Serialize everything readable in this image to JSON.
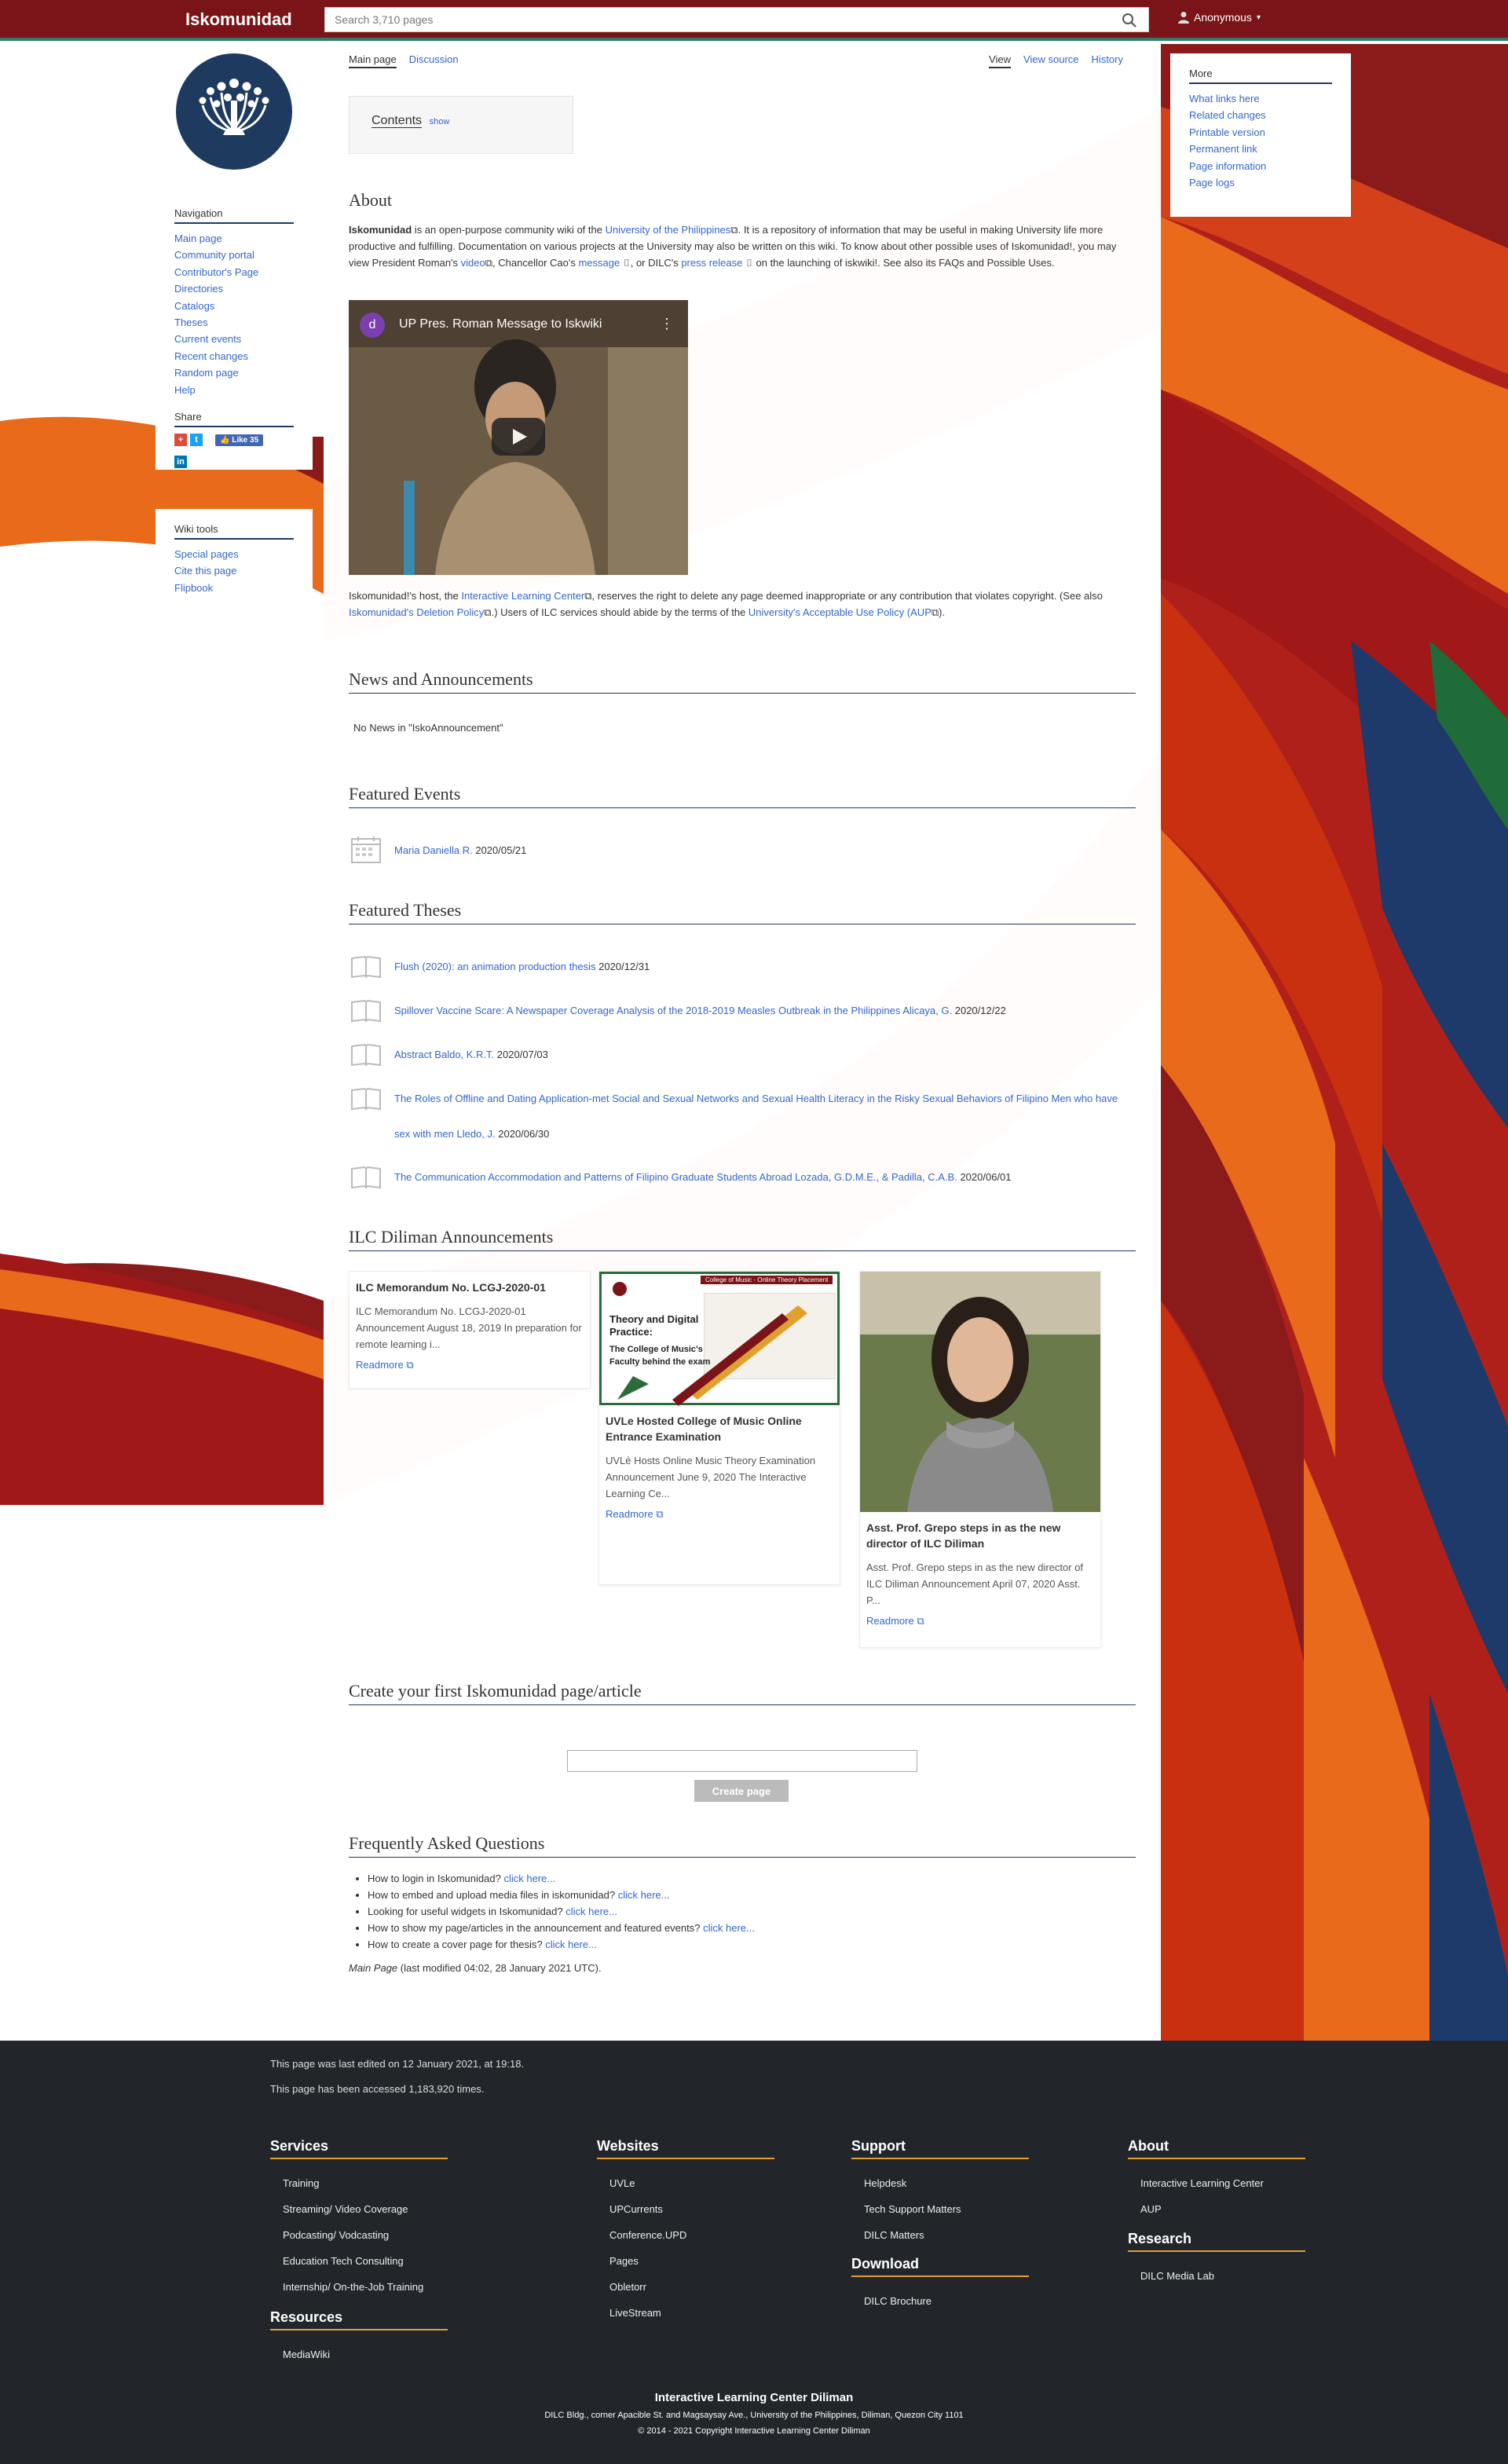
{
  "topbar": {
    "title": "Iskomunidad",
    "search_placeholder": "Search 3,710 pages",
    "user": "Anonymous"
  },
  "nav": {
    "heading": "Navigation",
    "items": [
      "Main page",
      "Community portal",
      "Contributor's Page",
      "Directories",
      "Catalogs",
      "Theses",
      "Current events",
      "Recent changes",
      "Random page",
      "Help"
    ],
    "share_heading": "Share",
    "like_label": "Like 35"
  },
  "tools": {
    "heading": "Wiki tools",
    "items": [
      "Special pages",
      "Cite this page",
      "Flipbook"
    ]
  },
  "more": {
    "heading": "More",
    "items": [
      "What links here",
      "Related changes",
      "Printable version",
      "Permanent link",
      "Page information",
      "Page logs"
    ]
  },
  "tabs": {
    "main": "Main page",
    "discussion": "Discussion",
    "view": "View",
    "view_source": "View source",
    "history": "History"
  },
  "toc": {
    "title": "Contents",
    "toggle": "show"
  },
  "about": {
    "heading": "About",
    "p1_bold": "Iskomunidad",
    "p1_a": " is an open-purpose community wiki of the ",
    "p1_link1": "University of the Philippines",
    "p1_b": ". It is a repository of information that may be useful in making University life more productive and fulfilling. Documentation on various projects at the University may also be written on this wiki. To know about other possible uses of Iskomunidad!, you may view President Roman's ",
    "p1_link2": "video",
    "p1_c": ", Chancellor Cao's ",
    "p1_link3": "message",
    "p1_d": ", or DILC's ",
    "p1_link4": "press release",
    "p1_e": " on the launching of iskwiki!. See also its FAQs and Possible Uses.",
    "video_title": "UP Pres. Roman Message to Iskwiki",
    "video_avatar": "d",
    "p2_a": "Iskomunidad!'s host, the ",
    "p2_link1": "Interactive Learning Center",
    "p2_b": ", reserves the right to delete any page deemed inappropriate or any contribution that violates copyright. (See also ",
    "p2_link2": "Iskomunidad's Deletion Policy",
    "p2_c": ".) Users of ILC services should abide by the terms of the ",
    "p2_link3": "University's Acceptable Use Policy (AUP",
    "p2_d": ")."
  },
  "news": {
    "heading": "News and Announcements",
    "empty": "No News in \"IskoAnnouncement\""
  },
  "events": {
    "heading": "Featured Events",
    "items": [
      {
        "title": "Maria Daniella R.",
        "date": "2020/05/21"
      }
    ]
  },
  "theses": {
    "heading": "Featured Theses",
    "items": [
      {
        "title": "Flush (2020): an animation production thesis",
        "date": "2020/12/31"
      },
      {
        "title": "Spillover Vaccine Scare: A Newspaper Coverage Analysis of the 2018-2019 Measles Outbreak in the Philippines Alicaya, G.",
        "date": "2020/12/22"
      },
      {
        "title": "Abstract Baldo, K.R.T.",
        "date": "2020/07/03"
      },
      {
        "title": "The Roles of Offline and Dating Application-met Social and Sexual Networks and Sexual Health Literacy in the Risky Sexual Behaviors of Filipino Men who have sex with men Lledo, J.",
        "date": "2020/06/30"
      },
      {
        "title": "The Communication Accommodation and Patterns of Filipino Graduate Students Abroad Lozada, G.D.M.E., & Padilla, C.A.B.",
        "date": "2020/06/01"
      }
    ]
  },
  "ilc": {
    "heading": "ILC Diliman Announcements",
    "cards": [
      {
        "title": "ILC Memorandum No. LCGJ-2020-01",
        "body": "ILC Memorandum No. LCGJ-2020-01 Announcement August 18, 2019 In preparation for remote learning i...",
        "more": "Readmore"
      },
      {
        "title": "UVLe Hosted College of Music Online Entrance Examination",
        "body": "UVLè Hosts Online Music Theory Examination Announcement June 9, 2020 The Interactive Learning Ce...",
        "more": "Readmore",
        "image_text": [
          "Theory and Digital",
          "Practice:",
          "The College of Music's",
          "Faculty behind the exam"
        ],
        "image_header": "College of Music · Online Theory Placement"
      },
      {
        "title": "Asst. Prof. Grepo steps in as the new director of ILC Diliman",
        "body": "Asst. Prof. Grepo steps in as the new director of ILC Diliman Announcement April 07, 2020 Asst. P...",
        "more": "Readmore"
      }
    ]
  },
  "create": {
    "heading": "Create your first Iskomunidad page/article",
    "button": "Create page"
  },
  "faq": {
    "heading": "Frequently Asked Questions",
    "items": [
      {
        "q": "How to login in Iskomunidad?",
        "link": "click here..."
      },
      {
        "q": "How to embed and upload media files in iskomunidad?",
        "link": "click here..."
      },
      {
        "q": "Looking for useful widgets in Iskomunidad?",
        "link": "click here..."
      },
      {
        "q": "How to show my page/articles in the announcement and featured events?",
        "link": "click here..."
      },
      {
        "q": "How to create a cover page for thesis?",
        "link": "click here..."
      }
    ],
    "modified_italic": "Main Page",
    "modified_rest": " (last modified 04:02, 28 January 2021 UTC)."
  },
  "footer": {
    "last_edited": "This page was last edited on 12 January 2021, at 19:18.",
    "accessed": "This page has been accessed 1,183,920 times.",
    "services": {
      "heading": "Services",
      "items": [
        "Training",
        "Streaming/ Video Coverage",
        "Podcasting/ Vodcasting",
        "Education Tech Consulting",
        "Internship/ On-the-Job Training"
      ]
    },
    "resources": {
      "heading": "Resources",
      "items": [
        "MediaWiki"
      ]
    },
    "websites": {
      "heading": "Websites",
      "items": [
        "UVLe",
        "UPCurrents",
        "Conference.UPD",
        "Pages",
        "Obletorr",
        "LiveStream"
      ]
    },
    "support": {
      "heading": "Support",
      "items": [
        "Helpdesk",
        "Tech Support Matters",
        "DILC Matters"
      ]
    },
    "download": {
      "heading": "Download",
      "items": [
        "DILC Brochure"
      ]
    },
    "about": {
      "heading": "About",
      "items": [
        "Interactive Learning Center",
        "AUP"
      ]
    },
    "research": {
      "heading": "Research",
      "items": [
        "DILC Media Lab"
      ]
    },
    "org": "Interactive Learning Center Diliman",
    "address": "DILC Bldg., corner Apacible St. and Magsaysay Ave., University of the Philippines, Diliman, Quezon City 1101",
    "copyright": "© 2014 - 2021 Copyright Interactive Learning Center Diliman"
  },
  "colors": {
    "topbar": "#7b1418",
    "navy": "#1e3a5f",
    "link": "#3366cc",
    "footer": "#22262b",
    "accent": "#e0a030"
  }
}
